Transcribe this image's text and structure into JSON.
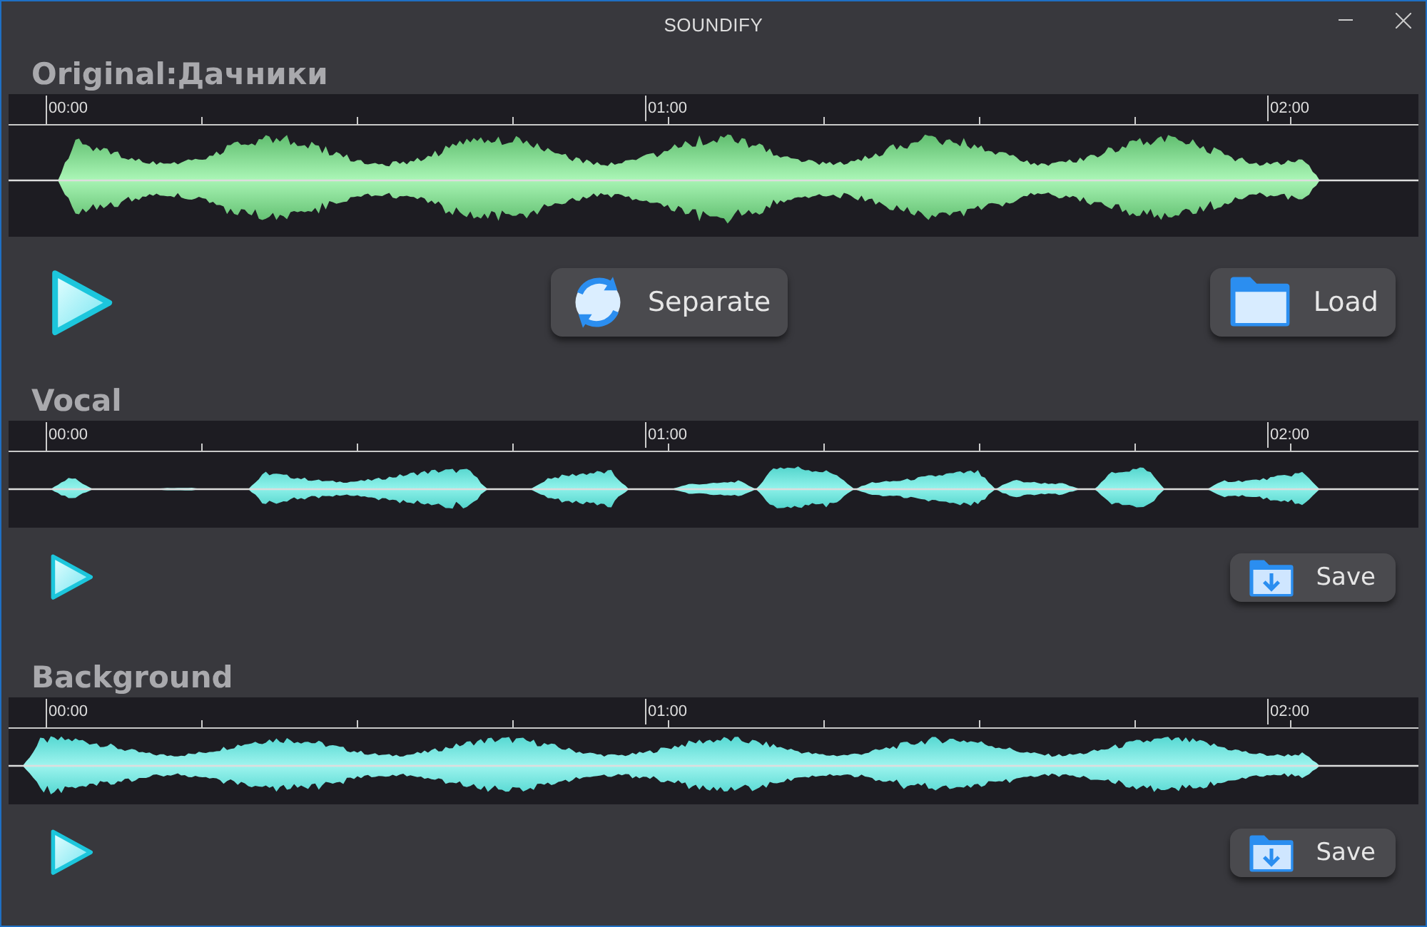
{
  "window": {
    "title": "SOUNDIFY"
  },
  "tracks": [
    {
      "kind": "original",
      "label": "Original:Дачники",
      "time_labels": [
        "00:00",
        "01:00",
        "02:00"
      ],
      "buttons": [
        {
          "kind": "separate",
          "label": "Separate"
        },
        {
          "kind": "load",
          "label": "Load"
        }
      ]
    },
    {
      "kind": "vocal",
      "label": "Vocal",
      "time_labels": [
        "00:00",
        "01:00",
        "02:00"
      ],
      "buttons": [
        {
          "kind": "save",
          "label": "Save"
        }
      ]
    },
    {
      "kind": "background",
      "label": "Background",
      "time_labels": [
        "00:00",
        "01:00",
        "02:00"
      ],
      "buttons": [
        {
          "kind": "save",
          "label": "Save"
        }
      ]
    }
  ]
}
